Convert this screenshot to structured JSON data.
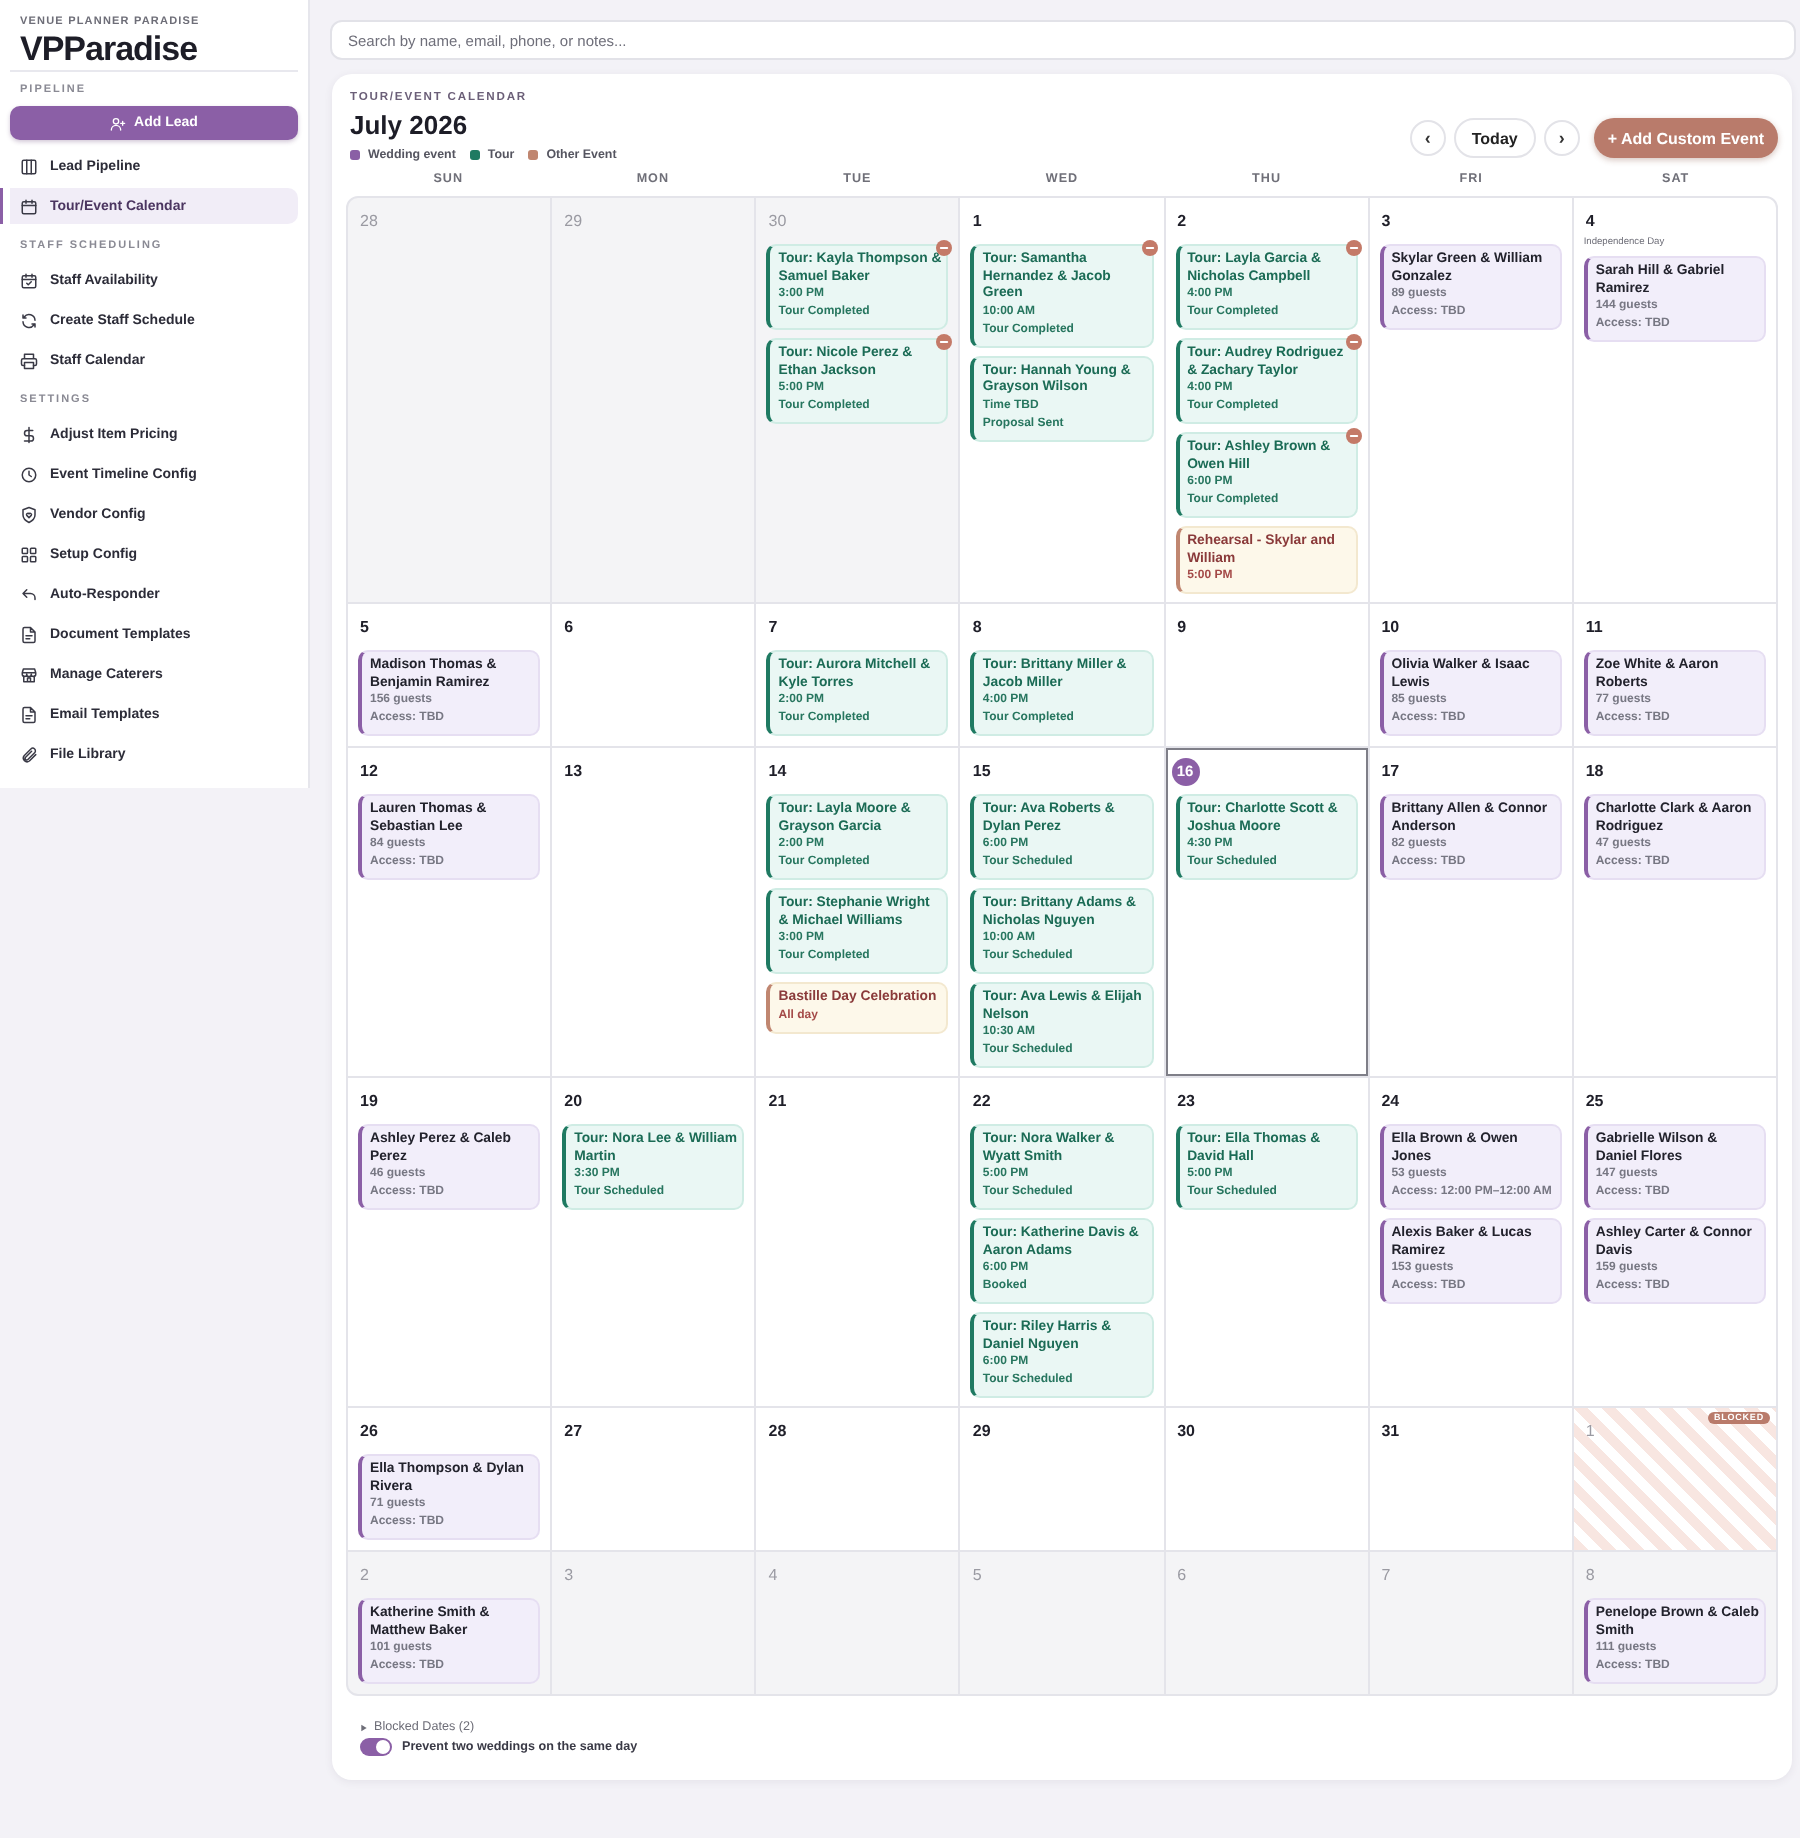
{
  "sidebar": {
    "caption": "VENUE PLANNER PARADISE",
    "brand": "VPParadise",
    "sections": [
      {
        "title": "PIPELINE",
        "button": "Add Lead",
        "items": [
          {
            "label": "Lead Pipeline",
            "selected": false
          },
          {
            "label": "Tour/Event Calendar",
            "selected": true
          }
        ]
      },
      {
        "title": "STAFF SCHEDULING",
        "items": [
          {
            "label": "Staff Availability",
            "selected": false
          },
          {
            "label": "Create Staff Schedule",
            "selected": false
          },
          {
            "label": "Staff Calendar",
            "selected": false
          }
        ]
      },
      {
        "title": "SETTINGS",
        "items": [
          {
            "label": "Adjust Item Pricing",
            "selected": false
          },
          {
            "label": "Event Timeline Config",
            "selected": false
          },
          {
            "label": "Vendor Config",
            "selected": false
          },
          {
            "label": "Setup Config",
            "selected": false
          },
          {
            "label": "Auto-Responder",
            "selected": false
          },
          {
            "label": "Document Templates",
            "selected": false
          },
          {
            "label": "Manage Caterers",
            "selected": false
          },
          {
            "label": "Email Templates",
            "selected": false
          },
          {
            "label": "File Library",
            "selected": false
          }
        ]
      }
    ]
  },
  "search": {
    "placeholder": "Search by name, email, phone, or notes..."
  },
  "calendar": {
    "caption": "TOUR/EVENT CALENDAR",
    "title": "July 2026",
    "legend": [
      {
        "label": "Wedding event",
        "color": "#8a5fa5"
      },
      {
        "label": "Tour",
        "color": "#1f7a62"
      },
      {
        "label": "Other Event",
        "color": "#c08670"
      }
    ],
    "nav": {
      "prev": "‹",
      "today": "Today",
      "next": "›"
    },
    "add_button": "+ Add Custom Event",
    "weekdays": [
      "SUN",
      "MON",
      "TUE",
      "WED",
      "THU",
      "FRI",
      "SAT"
    ],
    "weeks": [
      [
        {
          "number": "28",
          "outside": true,
          "today": false,
          "blocked": false
        },
        {
          "number": "29",
          "outside": true,
          "today": false,
          "blocked": false
        },
        {
          "number": "30",
          "outside": true,
          "today": false,
          "blocked": false,
          "events": [
            {
              "kind": "tour",
              "title": "Tour: Kayla Thompson & Samuel Baker",
              "lines": [
                "3:00 PM",
                "Tour Completed"
              ],
              "alert": true
            },
            {
              "kind": "tour",
              "title": "Tour: Nicole Perez & Ethan Jackson",
              "lines": [
                "5:00 PM",
                "Tour Completed"
              ],
              "alert": true
            }
          ]
        },
        {
          "number": "1",
          "outside": false,
          "today": false,
          "blocked": false,
          "events": [
            {
              "kind": "tour",
              "title": "Tour: Samantha Hernandez & Jacob Green",
              "lines": [
                "10:00 AM",
                "Tour Completed"
              ],
              "alert": true
            },
            {
              "kind": "tour",
              "title": "Tour: Hannah Young & Grayson Wilson",
              "lines": [
                "Time TBD",
                "Proposal Sent"
              ],
              "alert": false
            }
          ]
        },
        {
          "number": "2",
          "outside": false,
          "today": false,
          "blocked": false,
          "events": [
            {
              "kind": "tour",
              "title": "Tour: Layla Garcia & Nicholas Campbell",
              "lines": [
                "4:00 PM",
                "Tour Completed"
              ],
              "alert": true
            },
            {
              "kind": "tour",
              "title": "Tour: Audrey Rodriguez & Zachary Taylor",
              "lines": [
                "4:00 PM",
                "Tour Completed"
              ],
              "alert": true
            },
            {
              "kind": "tour",
              "title": "Tour: Ashley Brown & Owen Hill",
              "lines": [
                "6:00 PM",
                "Tour Completed"
              ],
              "alert": true
            },
            {
              "kind": "other",
              "title": "Rehearsal - Skylar and William",
              "lines": [
                "5:00 PM"
              ],
              "alert": false
            }
          ]
        },
        {
          "number": "3",
          "outside": false,
          "today": false,
          "blocked": false,
          "events": [
            {
              "kind": "wedding",
              "title": "Skylar Green & William Gonzalez",
              "lines": [
                "89 guests",
                "Access: TBD"
              ],
              "alert": false
            }
          ]
        },
        {
          "number": "4",
          "outside": false,
          "today": false,
          "blocked": false,
          "holiday": "Independence Day",
          "events": [
            {
              "kind": "wedding",
              "title": "Sarah Hill & Gabriel Ramirez",
              "lines": [
                "144 guests",
                "Access: TBD"
              ],
              "alert": false
            }
          ]
        }
      ],
      [
        {
          "number": "5",
          "outside": false,
          "today": false,
          "blocked": false,
          "events": [
            {
              "kind": "wedding",
              "title": "Madison Thomas & Benjamin Ramirez",
              "lines": [
                "156 guests",
                "Access: TBD"
              ],
              "alert": false
            }
          ]
        },
        {
          "number": "6",
          "outside": false,
          "today": false,
          "blocked": false
        },
        {
          "number": "7",
          "outside": false,
          "today": false,
          "blocked": false,
          "events": [
            {
              "kind": "tour",
              "title": "Tour: Aurora Mitchell & Kyle Torres",
              "lines": [
                "2:00 PM",
                "Tour Completed"
              ],
              "alert": false
            }
          ]
        },
        {
          "number": "8",
          "outside": false,
          "today": false,
          "blocked": false,
          "events": [
            {
              "kind": "tour",
              "title": "Tour: Brittany Miller & Jacob Miller",
              "lines": [
                "4:00 PM",
                "Tour Completed"
              ],
              "alert": false
            }
          ]
        },
        {
          "number": "9",
          "outside": false,
          "today": false,
          "blocked": false
        },
        {
          "number": "10",
          "outside": false,
          "today": false,
          "blocked": false,
          "events": [
            {
              "kind": "wedding",
              "title": "Olivia Walker & Isaac Lewis",
              "lines": [
                "85 guests",
                "Access: TBD"
              ],
              "alert": false
            }
          ]
        },
        {
          "number": "11",
          "outside": false,
          "today": false,
          "blocked": false,
          "events": [
            {
              "kind": "wedding",
              "title": "Zoe White & Aaron Roberts",
              "lines": [
                "77 guests",
                "Access: TBD"
              ],
              "alert": false
            }
          ]
        }
      ],
      [
        {
          "number": "12",
          "outside": false,
          "today": false,
          "blocked": false,
          "events": [
            {
              "kind": "wedding",
              "title": "Lauren Thomas & Sebastian Lee",
              "lines": [
                "84 guests",
                "Access: TBD"
              ],
              "alert": false
            }
          ]
        },
        {
          "number": "13",
          "outside": false,
          "today": false,
          "blocked": false
        },
        {
          "number": "14",
          "outside": false,
          "today": false,
          "blocked": false,
          "events": [
            {
              "kind": "tour",
              "title": "Tour: Layla Moore & Grayson Garcia",
              "lines": [
                "2:00 PM",
                "Tour Completed"
              ],
              "alert": false
            },
            {
              "kind": "tour",
              "title": "Tour: Stephanie Wright & Michael Williams",
              "lines": [
                "3:00 PM",
                "Tour Completed"
              ],
              "alert": false
            },
            {
              "kind": "other",
              "title": "Bastille Day Celebration",
              "lines": [
                "All day"
              ],
              "alert": false
            }
          ]
        },
        {
          "number": "15",
          "outside": false,
          "today": false,
          "blocked": false,
          "events": [
            {
              "kind": "tour",
              "title": "Tour: Ava Roberts & Dylan Perez",
              "lines": [
                "6:00 PM",
                "Tour Scheduled"
              ],
              "alert": false
            },
            {
              "kind": "tour",
              "title": "Tour: Brittany Adams & Nicholas Nguyen",
              "lines": [
                "10:00 AM",
                "Tour Scheduled"
              ],
              "alert": false
            },
            {
              "kind": "tour",
              "title": "Tour: Ava Lewis & Elijah Nelson",
              "lines": [
                "10:30 AM",
                "Tour Scheduled"
              ],
              "alert": false
            }
          ]
        },
        {
          "number": "16",
          "outside": false,
          "today": true,
          "blocked": false,
          "events": [
            {
              "kind": "tour",
              "title": "Tour: Charlotte Scott & Joshua Moore",
              "lines": [
                "4:30 PM",
                "Tour Scheduled"
              ],
              "alert": false
            }
          ]
        },
        {
          "number": "17",
          "outside": false,
          "today": false,
          "blocked": false,
          "events": [
            {
              "kind": "wedding",
              "title": "Brittany Allen & Connor Anderson",
              "lines": [
                "82 guests",
                "Access: TBD"
              ],
              "alert": false
            }
          ]
        },
        {
          "number": "18",
          "outside": false,
          "today": false,
          "blocked": false,
          "events": [
            {
              "kind": "wedding",
              "title": "Charlotte Clark & Aaron Rodriguez",
              "lines": [
                "47 guests",
                "Access: TBD"
              ],
              "alert": false
            }
          ]
        }
      ],
      [
        {
          "number": "19",
          "outside": false,
          "today": false,
          "blocked": false,
          "events": [
            {
              "kind": "wedding",
              "title": "Ashley Perez & Caleb Perez",
              "lines": [
                "46 guests",
                "Access: TBD"
              ],
              "alert": false
            }
          ]
        },
        {
          "number": "20",
          "outside": false,
          "today": false,
          "blocked": false,
          "events": [
            {
              "kind": "tour",
              "title": "Tour: Nora Lee & William Martin",
              "lines": [
                "3:30 PM",
                "Tour Scheduled"
              ],
              "alert": false
            }
          ]
        },
        {
          "number": "21",
          "outside": false,
          "today": false,
          "blocked": false
        },
        {
          "number": "22",
          "outside": false,
          "today": false,
          "blocked": false,
          "events": [
            {
              "kind": "tour",
              "title": "Tour: Nora Walker & Wyatt Smith",
              "lines": [
                "5:00 PM",
                "Tour Scheduled"
              ],
              "alert": false
            },
            {
              "kind": "tour",
              "title": "Tour: Katherine Davis & Aaron Adams",
              "lines": [
                "6:00 PM",
                "Booked"
              ],
              "alert": false
            },
            {
              "kind": "tour",
              "title": "Tour: Riley Harris & Daniel Nguyen",
              "lines": [
                "6:00 PM",
                "Tour Scheduled"
              ],
              "alert": false
            }
          ]
        },
        {
          "number": "23",
          "outside": false,
          "today": false,
          "blocked": false,
          "events": [
            {
              "kind": "tour",
              "title": "Tour: Ella Thomas & David Hall",
              "lines": [
                "5:00 PM",
                "Tour Scheduled"
              ],
              "alert": false
            }
          ]
        },
        {
          "number": "24",
          "outside": false,
          "today": false,
          "blocked": false,
          "events": [
            {
              "kind": "wedding",
              "title": "Ella Brown & Owen Jones",
              "lines": [
                "53 guests",
                "Access: 12:00 PM–12:00 AM"
              ],
              "alert": false
            },
            {
              "kind": "wedding",
              "title": "Alexis Baker & Lucas Ramirez",
              "lines": [
                "153 guests",
                "Access: TBD"
              ],
              "alert": false
            }
          ]
        },
        {
          "number": "25",
          "outside": false,
          "today": false,
          "blocked": false,
          "events": [
            {
              "kind": "wedding",
              "title": "Gabrielle Wilson & Daniel Flores",
              "lines": [
                "147 guests",
                "Access: TBD"
              ],
              "alert": false
            },
            {
              "kind": "wedding",
              "title": "Ashley Carter & Connor Davis",
              "lines": [
                "159 guests",
                "Access: TBD"
              ],
              "alert": false
            }
          ]
        }
      ],
      [
        {
          "number": "26",
          "outside": false,
          "today": false,
          "blocked": false,
          "events": [
            {
              "kind": "wedding",
              "title": "Ella Thompson & Dylan Rivera",
              "lines": [
                "71 guests",
                "Access: TBD"
              ],
              "alert": false
            }
          ]
        },
        {
          "number": "27",
          "outside": false,
          "today": false,
          "blocked": false
        },
        {
          "number": "28",
          "outside": false,
          "today": false,
          "blocked": false
        },
        {
          "number": "29",
          "outside": false,
          "today": false,
          "blocked": false
        },
        {
          "number": "30",
          "outside": false,
          "today": false,
          "blocked": false
        },
        {
          "number": "31",
          "outside": false,
          "today": false,
          "blocked": false
        },
        {
          "number": "1",
          "outside": true,
          "today": false,
          "blocked": true,
          "badge": "BLOCKED"
        }
      ],
      [
        {
          "number": "2",
          "outside": true,
          "today": false,
          "blocked": false,
          "events": [
            {
              "kind": "wedding",
              "title": "Katherine Smith & Matthew Baker",
              "lines": [
                "101 guests",
                "Access: TBD"
              ],
              "alert": false
            }
          ]
        },
        {
          "number": "3",
          "outside": true,
          "today": false,
          "blocked": false
        },
        {
          "number": "4",
          "outside": true,
          "today": false,
          "blocked": false
        },
        {
          "number": "5",
          "outside": true,
          "today": false,
          "blocked": false
        },
        {
          "number": "6",
          "outside": true,
          "today": false,
          "blocked": false
        },
        {
          "number": "7",
          "outside": true,
          "today": false,
          "blocked": false
        },
        {
          "number": "8",
          "outside": true,
          "today": false,
          "blocked": false,
          "events": [
            {
              "kind": "wedding",
              "title": "Penelope Brown & Caleb Smith",
              "lines": [
                "111 guests",
                "Access: TBD"
              ],
              "alert": false
            }
          ]
        }
      ]
    ],
    "blocked_dates": {
      "label": "Blocked Dates (2)",
      "expanded": false
    },
    "prevent_double_booking": {
      "label": "Prevent two weddings on the same day",
      "on": true
    }
  }
}
